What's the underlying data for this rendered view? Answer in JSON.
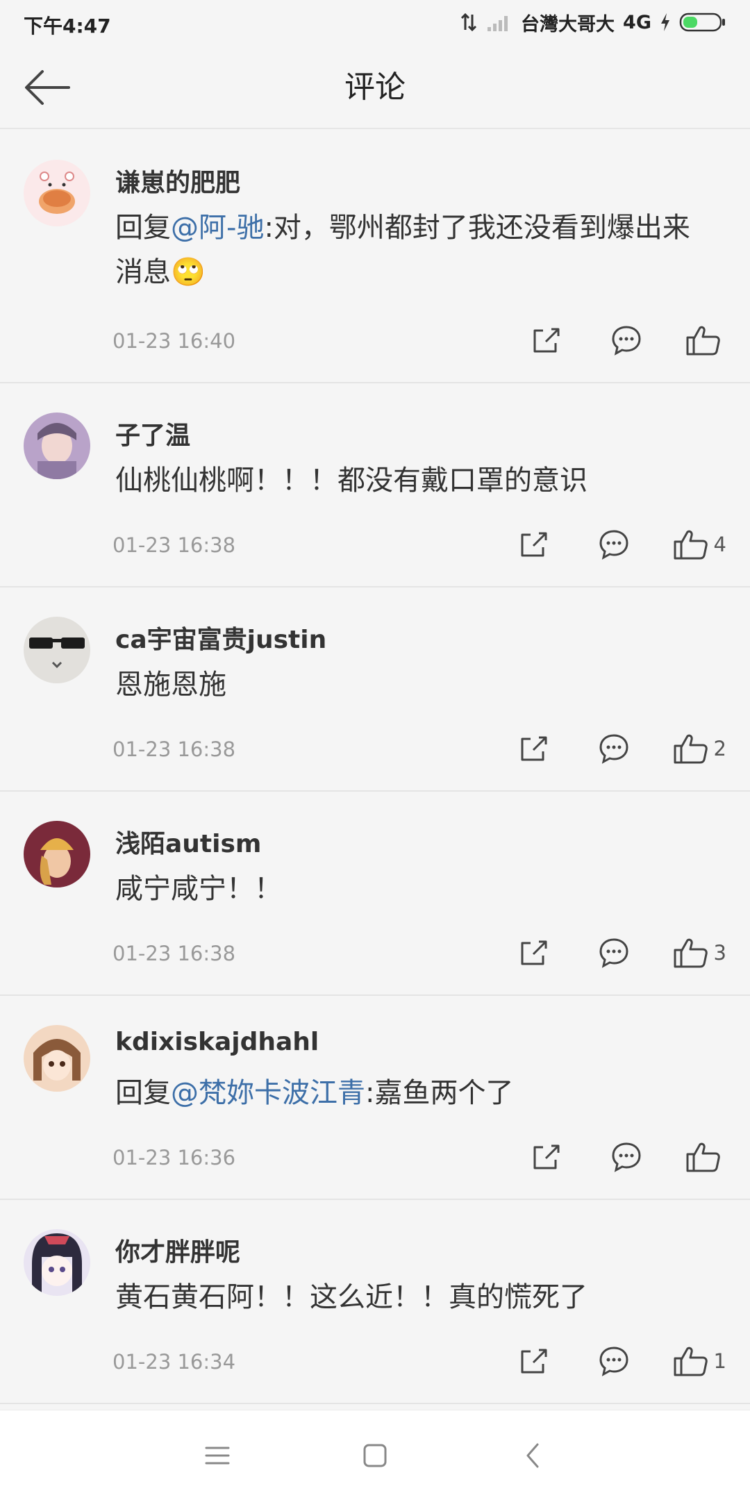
{
  "status_bar": {
    "time": "下午4:47",
    "carrier": "台灣大哥大",
    "network": "4G"
  },
  "header": {
    "title": "评论",
    "back_icon": "arrow-left-icon"
  },
  "comments": [
    {
      "username": "谦崽的肥肥",
      "reply_prefix": "回复",
      "mention": "@阿-驰",
      "text": ":对，鄂州都封了我还没看到爆出来消息",
      "emoji": "🙄",
      "time": "01-23 16:40",
      "likes": "",
      "avatar_colors": [
        "#fbe9ea",
        "#f0a46a"
      ]
    },
    {
      "username": "子了温",
      "reply_prefix": "",
      "mention": "",
      "text": "仙桃仙桃啊！！！都没有戴口罩的意识",
      "emoji": "",
      "time": "01-23 16:38",
      "likes": "4",
      "avatar_colors": [
        "#b9a3c9",
        "#6b5a78"
      ]
    },
    {
      "username": "ca宇宙富贵justin",
      "reply_prefix": "",
      "mention": "",
      "text": "恩施恩施",
      "emoji": "",
      "time": "01-23 16:38",
      "likes": "2",
      "avatar_colors": [
        "#e2e0dc",
        "#1b1b1b"
      ]
    },
    {
      "username": "浅陌autism",
      "reply_prefix": "",
      "mention": "",
      "text": "咸宁咸宁！！",
      "emoji": "",
      "time": "01-23 16:38",
      "likes": "3",
      "avatar_colors": [
        "#7a2a3a",
        "#e6b04a"
      ]
    },
    {
      "username": "kdixiskajdhahl",
      "reply_prefix": "回复",
      "mention": "@梵妳卡波江青",
      "text": ":嘉鱼两个了",
      "emoji": "",
      "time": "01-23 16:36",
      "likes": "",
      "avatar_colors": [
        "#f3d8c2",
        "#8a5a3a"
      ]
    },
    {
      "username": "你才胖胖呢",
      "reply_prefix": "",
      "mention": "",
      "text": "黄石黄石阿！！这么近！！真的慌死了",
      "emoji": "",
      "time": "01-23 16:34",
      "likes": "1",
      "avatar_colors": [
        "#e9e4f2",
        "#2d2a3e"
      ]
    }
  ],
  "actions": {
    "share_icon": "share-icon",
    "comment_icon": "comment-bubble-icon",
    "like_icon": "thumbs-up-icon"
  },
  "nav_bar": {
    "menu_icon": "menu-icon",
    "home_icon": "home-square-icon",
    "back_icon": "back-chevron-icon"
  }
}
